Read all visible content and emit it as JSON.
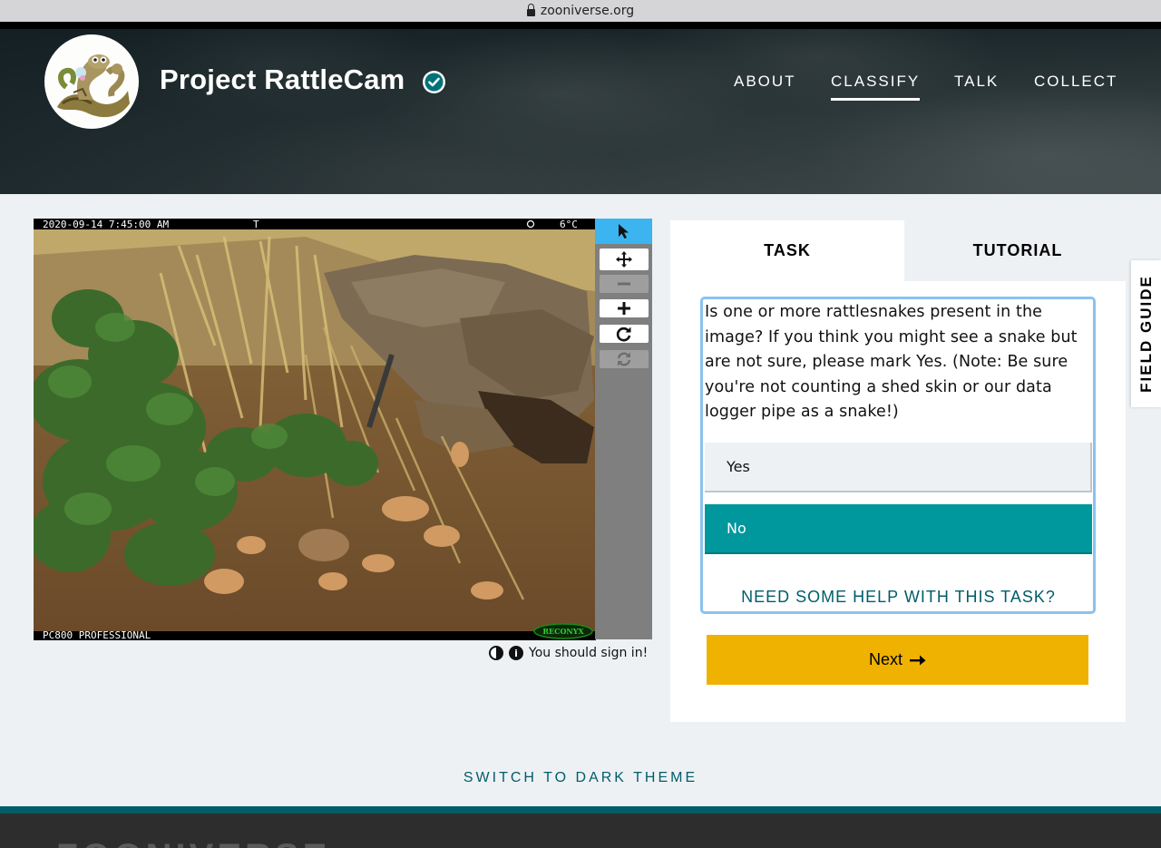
{
  "browser": {
    "url": "zooniverse.org"
  },
  "project": {
    "title": "Project RattleCam",
    "logo_icon": "snake-mascot-icon"
  },
  "nav": {
    "about": "ABOUT",
    "classify": "CLASSIFY",
    "talk": "TALK",
    "collect": "COLLECT",
    "active": "CLASSIFY"
  },
  "subject": {
    "timestamp": "2020-09-14 7:45:00 AM",
    "t_label": "T",
    "temp": "6°C",
    "camera": "PC800 PROFESSIONAL",
    "brand": "RECONYX"
  },
  "toolbar": {
    "tools": [
      {
        "name": "pointer",
        "icon": "cursor-icon",
        "state": "selected"
      },
      {
        "name": "move",
        "icon": "move-arrows-icon",
        "state": "enabled"
      },
      {
        "name": "zoom-out",
        "icon": "minus-icon",
        "state": "disabled"
      },
      {
        "name": "zoom-in",
        "icon": "plus-icon",
        "state": "enabled"
      },
      {
        "name": "rotate",
        "icon": "rotate-icon",
        "state": "enabled"
      },
      {
        "name": "reset",
        "icon": "reset-icon",
        "state": "disabled"
      }
    ]
  },
  "meta": {
    "signin_text": "You should sign in!"
  },
  "panel": {
    "tab_task": "TASK",
    "tab_tutorial": "TUTORIAL",
    "question": "Is one or more rattlesnakes present in the image? If you think you might see a snake but are not sure, please mark Yes. (Note: Be sure you're not counting a shed skin or our data logger pipe as a snake!)",
    "answers": [
      {
        "label": "Yes",
        "selected": false
      },
      {
        "label": "No",
        "selected": true
      }
    ],
    "help": "NEED SOME HELP WITH THIS TASK?",
    "next": "Next",
    "next_icon": "arrow-right-icon"
  },
  "field_guide": "FIELD GUIDE",
  "theme_toggle": "SWITCH TO DARK THEME",
  "footer": {
    "brand": "ZOONIVERSE"
  },
  "colors": {
    "teal": "#005d69",
    "selected_answer": "#00979d",
    "next_button": "#f0b200",
    "selected_tool": "#3bb4ef",
    "focus_border": "#8ac2f0"
  }
}
